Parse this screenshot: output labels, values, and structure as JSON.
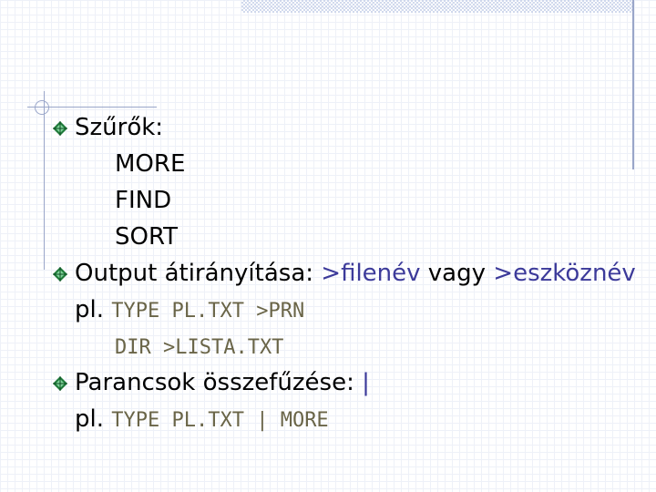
{
  "colors": {
    "accent": "#3c3a9a",
    "code": "#6a6548",
    "bullet_diamond": "#1f7a3a",
    "frame": "#9aa6c9"
  },
  "slide": {
    "filters": {
      "heading": "Szűrők:",
      "items": [
        "MORE",
        "FIND",
        "SORT"
      ]
    },
    "redirection": {
      "heading": "Output átirányítása: ",
      "target1": ">filenév",
      "or_word": " vagy ",
      "target2": ">eszköznév",
      "example_label": "pl. ",
      "example1": "TYPE PL.TXT >PRN",
      "example2": "DIR >LISTA.TXT"
    },
    "piping": {
      "heading": "Parancsok összefűzése: ",
      "pipe": "|",
      "example_label": "pl. ",
      "example": "TYPE PL.TXT | MORE"
    }
  }
}
